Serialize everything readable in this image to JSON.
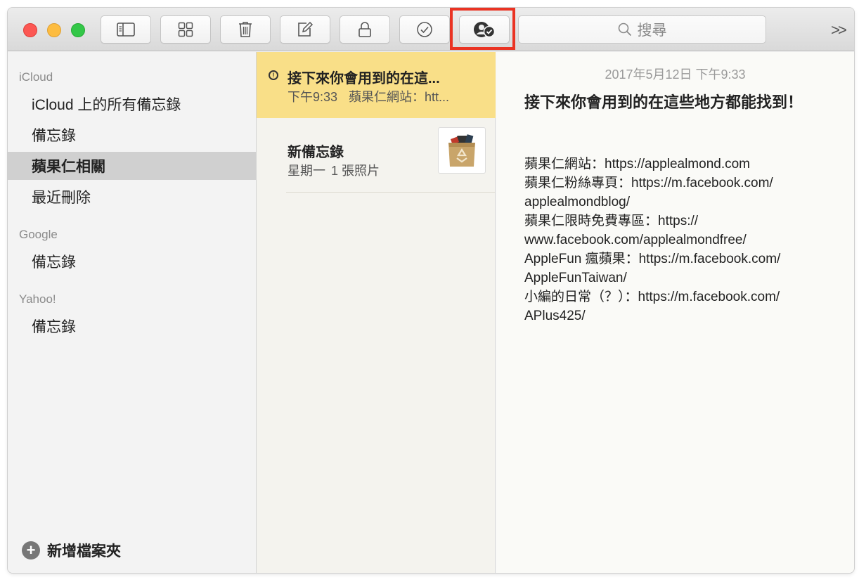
{
  "toolbar": {
    "buttons": [
      {
        "name": "sidebar-toggle",
        "icon": "sidebar-icon"
      },
      {
        "name": "attachments-browser",
        "icon": "grid-icon"
      },
      {
        "name": "delete-note",
        "icon": "trash-icon"
      },
      {
        "name": "new-note",
        "icon": "compose-icon"
      },
      {
        "name": "lock-note",
        "icon": "lock-icon"
      },
      {
        "name": "checklist",
        "icon": "checkmark-circle-icon"
      },
      {
        "name": "add-people",
        "icon": "add-people-icon"
      }
    ],
    "search_placeholder": "搜尋",
    "more_label": ">>",
    "highlight_color": "#ea3323"
  },
  "sidebar": {
    "accounts": [
      {
        "name": "iCloud",
        "folders": [
          "iCloud 上的所有備忘錄",
          "備忘錄",
          "蘋果仁相關",
          "最近刪除"
        ]
      },
      {
        "name": "Google",
        "folders": [
          "備忘錄"
        ]
      },
      {
        "name": "Yahoo!",
        "folders": [
          "備忘錄"
        ]
      }
    ],
    "selected_folder": "蘋果仁相關",
    "new_folder_label": "新增檔案夾"
  },
  "notes": [
    {
      "title": "接下來你會用到的在這...",
      "time": "下午9:33",
      "preview": "蘋果仁網站：htt...",
      "pinned_icon": "pin-icon",
      "selected": true
    },
    {
      "title": "新備忘錄",
      "time": "星期一",
      "preview": "1 張照片",
      "thumbnail_icon": "recycle-bag-icon",
      "selected": false
    }
  ],
  "detail": {
    "date": "2017年5月12日 下午9:33",
    "title": "接下來你會用到的在這些地方都能找到！",
    "lines": [
      "蘋果仁網站：https://applealmond.com",
      "蘋果仁粉絲專頁：https://m.facebook.com/",
      "applealmondblog/",
      "蘋果仁限時免費專區：https://",
      "www.facebook.com/applealmondfree/",
      "AppleFun 瘋蘋果：https://m.facebook.com/",
      "AppleFunTaiwan/",
      "小編的日常（？）：https://m.facebook.com/",
      "APlus425/"
    ]
  },
  "colors": {
    "selected_note_bg": "#f9df88",
    "selected_folder_bg": "#d0d0d0"
  }
}
